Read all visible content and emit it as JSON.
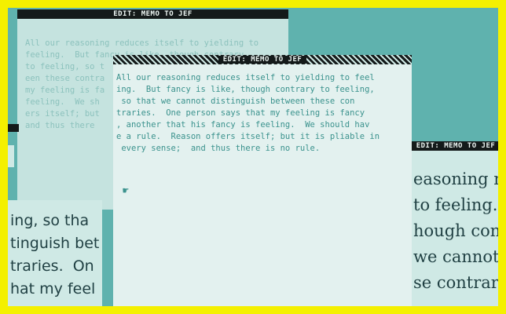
{
  "windows": {
    "back": {
      "title": "EDIT: MEMO TO JEF",
      "lines": [
        "All our reasoning reduces itself to yielding to",
        "feeling.  But fancy is like, though contrary",
        "to feeling, so t",
        "een these contra",
        "my feeling is fa",
        "feeling.  We sh",
        "ers itself; but",
        "and thus there"
      ]
    },
    "front": {
      "title": "EDIT: MEMO TO JEF",
      "lines": [
        "All our reasoning reduces itself to yielding to feel",
        "ing.  But fancy is like, though contrary to feeling,",
        " so that we cannot distinguish between these con",
        "traries.  One person says that my feeling is fancy",
        ", another that his fancy is feeling.  We should hav",
        "e a rule.  Reason offers itself; but it is pliable in",
        " every sense;  and thus there is no rule."
      ]
    },
    "right": {
      "title": "EDIT: MEMO TO JEF",
      "lines": [
        "easoning re",
        "to feeling.",
        "hough contr",
        "we cannot",
        "se contraries"
      ]
    },
    "left": {
      "lines": [
        "ing, so tha",
        "tinguish bet",
        "traries.  On",
        "hat my feel"
      ]
    }
  },
  "colors": {
    "frame": "#f4f000",
    "desktop": "#5fb2ae",
    "titlebar": "#141a1a",
    "window": "#e3f1ef",
    "text": "#3a928d"
  },
  "icons": {
    "pointer": "pointing-hand-icon"
  }
}
